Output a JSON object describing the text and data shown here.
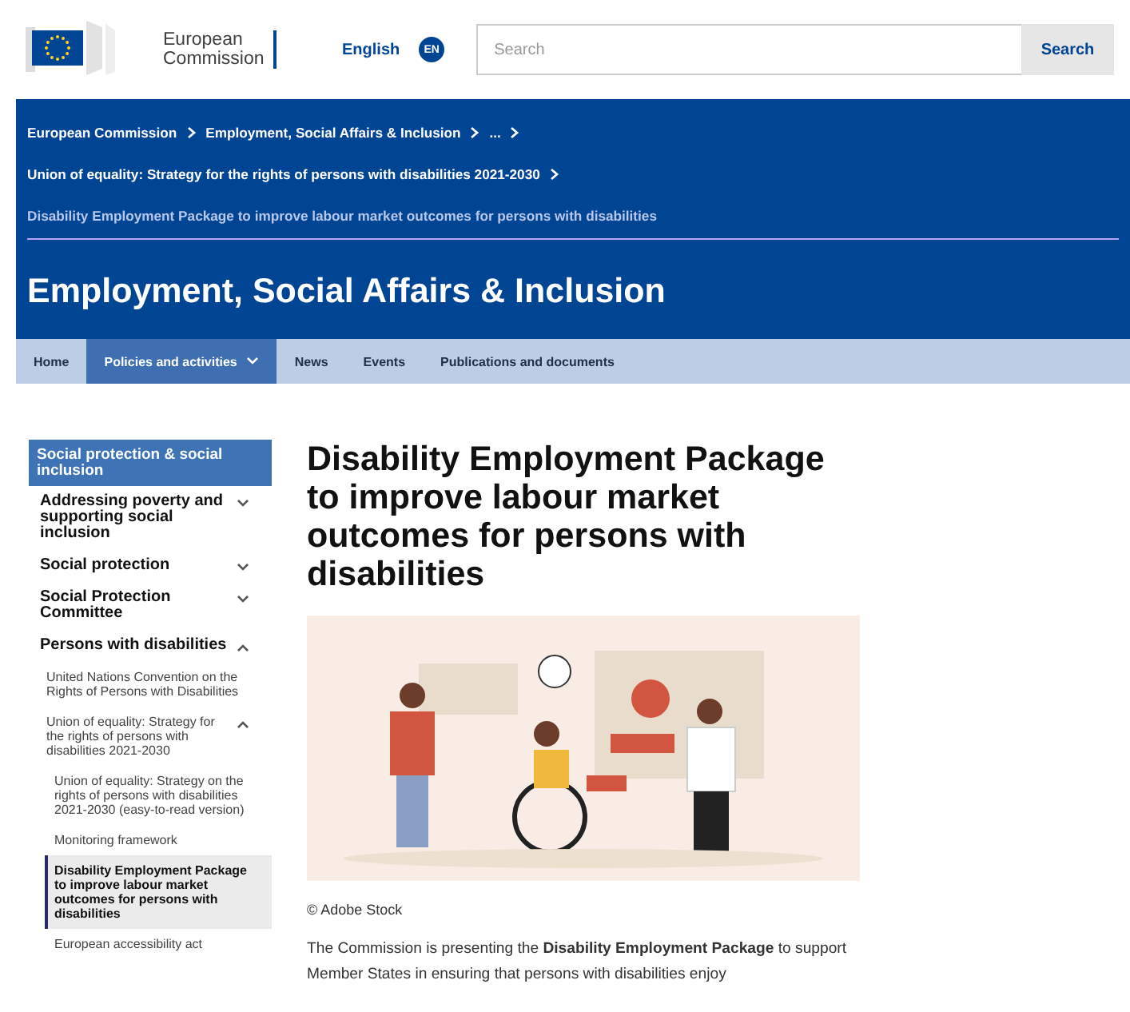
{
  "header": {
    "logo_lines": [
      "European",
      "Commission"
    ],
    "language": "English",
    "language_code": "EN",
    "search": {
      "placeholder": "Search",
      "button": "Search"
    }
  },
  "breadcrumb": [
    {
      "label": "European Commission",
      "arrow": true,
      "current": false
    },
    {
      "label": "Employment, Social Affairs & Inclusion",
      "arrow": true,
      "current": false
    },
    {
      "label": "...",
      "arrow": true,
      "current": false
    },
    {
      "label": "Union of equality: Strategy for the rights of persons with disabilities 2021-2030",
      "arrow": true,
      "current": false
    },
    {
      "label": "Disability Employment Package to improve labour market outcomes for persons with disabilities",
      "arrow": false,
      "current": true
    }
  ],
  "site_title": "Employment, Social Affairs & Inclusion",
  "nav": [
    {
      "label": "Home",
      "selected": false,
      "dropdown": false
    },
    {
      "label": "Policies and activities",
      "selected": true,
      "dropdown": true
    },
    {
      "label": "News",
      "selected": false,
      "dropdown": false
    },
    {
      "label": "Events",
      "selected": false,
      "dropdown": false
    },
    {
      "label": "Publications and documents",
      "selected": false,
      "dropdown": false
    }
  ],
  "sidebar": {
    "title": "Social protection & social inclusion",
    "items": [
      {
        "label": "Addressing poverty and supporting social inclusion",
        "expanded": false,
        "selected": false
      },
      {
        "label": "Social protection",
        "expanded": false,
        "selected": false
      },
      {
        "label": "Social Protection Committee",
        "expanded": false,
        "selected": false
      },
      {
        "label": "Persons with disabilities",
        "expanded": true,
        "selected": false,
        "children": [
          {
            "label": "United Nations Convention on the Rights of Persons with Disabilities",
            "selected": false
          },
          {
            "label": "Union of equality: Strategy for the rights of persons with disabilities 2021-2030",
            "expanded": true,
            "selected": false,
            "children": [
              {
                "label": "Union of equality: Strategy on the rights of persons with disabilities 2021-2030 (easy-to-read version)",
                "selected": false
              },
              {
                "label": "Monitoring framework",
                "selected": false
              },
              {
                "label": "Disability Employment Package to improve labour market outcomes for persons with disabilities",
                "selected": true
              },
              {
                "label": "European accessibility act",
                "selected": false
              }
            ]
          }
        ]
      }
    ]
  },
  "article": {
    "title": "Disability Employment Package to improve labour market outcomes for persons with disabilities",
    "image_credit": "© Adobe Stock",
    "body": "The Commission is presenting the **Disability Employment Package** to support Member States in ensuring that persons with disabilities enjoy"
  }
}
